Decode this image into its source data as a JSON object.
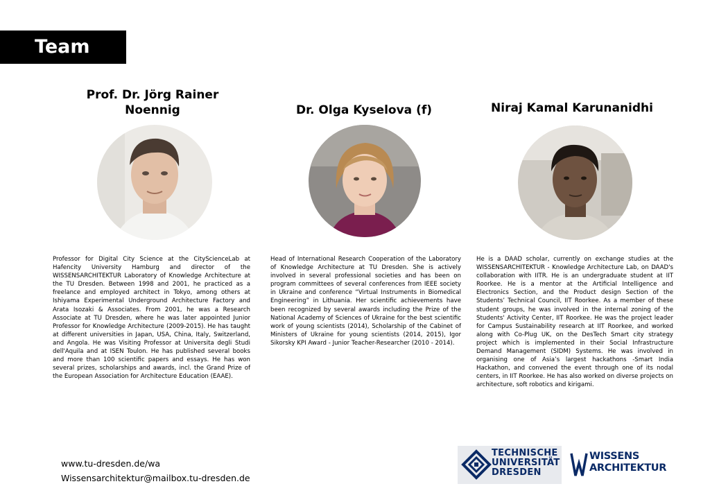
{
  "header": {
    "title": "Team"
  },
  "members": [
    {
      "name_line1": "Prof. Dr. Jörg  Rainer",
      "name_line2": "Noennig",
      "bio": "Professor for Digital City Science at the CityScienceLab at Hafencity University Hamburg and director of the WISSENSARCHITEKTUR Laboratory of Knowledge Architecture at the TU Dresden. Between 1998 and 2001, he practiced as a freelance and employed architect in Tokyo, among others at Ishiyama Experimental Underground Architecture Factory and Arata Isozaki & Associates. From 2001, he was a Research Associate at TU Dresden, where he was later appointed Junior Professor for Knowledge Architecture (2009-2015). He has taught at different universities in Japan, USA, China, Italy, Switzerland, and Angola. He was Visiting Professor at Universita degli Studi dell'Aquila and at ISEN Toulon. He has published several books and more than 100 scientific papers and essays. He has won several prizes, scholarships and awards, incl. the Grand Prize of the European Association for Architecture Education (EAAE)."
    },
    {
      "name_line1": "Dr. Olga Kyselova (f)",
      "bio": "Head of International Research Cooperation of the Laboratory of Knowledge Architecture at TU Dresden. She is actively involved in several professional societies and has been on program committees of several conferences from IEEE society in Ukraine and conference “Virtual Instruments in Biomedical Engineering” in Lithuania. Her scientific achievements have been recognized by several awards including the Prize of the National Academy of Sciences of Ukraine for the best scientific work of young scientists (2014), Scholarship of the Cabinet of Ministers of Ukraine for young scientists (2014, 2015), Igor Sikorsky KPI Award - Junior Teacher-Researcher (2010 - 2014)."
    },
    {
      "name_line1": "Niraj Kamal Karunanidhi",
      "bio": "He is a DAAD scholar, currently on exchange studies at the WISSENSARCHITEKTUR - Knowledge Architecture Lab, on DAAD's collaboration with IITR. He is an undergraduate student at IIT Roorkee. He is a mentor at the Artificial Intelligence and Electronics Section, and the Product design Section of the Students’ Technical Council, IIT Roorkee. As a member of these student groups, he was involved in the internal zoning of the Students' Activity Center, IIT Roorkee. He was the project leader for Campus Sustainability research at IIT Roorkee, and worked along with Co-Plug UK, on the DesTech Smart city strategy project which is implemented in their Social Infrastructure Demand Management (SIDM) Systems. He was involved in organising one of Asia’s largest hackathons -Smart India Hackathon, and convened the event through one of its nodal centers, in IIT Roorkee. He has also worked on diverse projects on architecture, soft robotics and kirigami."
    }
  ],
  "footer": {
    "website": "www.tu-dresden.de/wa",
    "email": "Wissensarchitektur@mailbox.tu-dresden.de"
  },
  "logos": {
    "tu_line1": "TECHNISCHE",
    "tu_line2": "UNIVERSITÄT",
    "tu_line3": "DRESDEN",
    "wa_line1": "WISSENS",
    "wa_line2": "ARCHITEKTUR"
  },
  "colors": {
    "title_bar": "#000000",
    "logo_blue": "#0a2a66"
  }
}
